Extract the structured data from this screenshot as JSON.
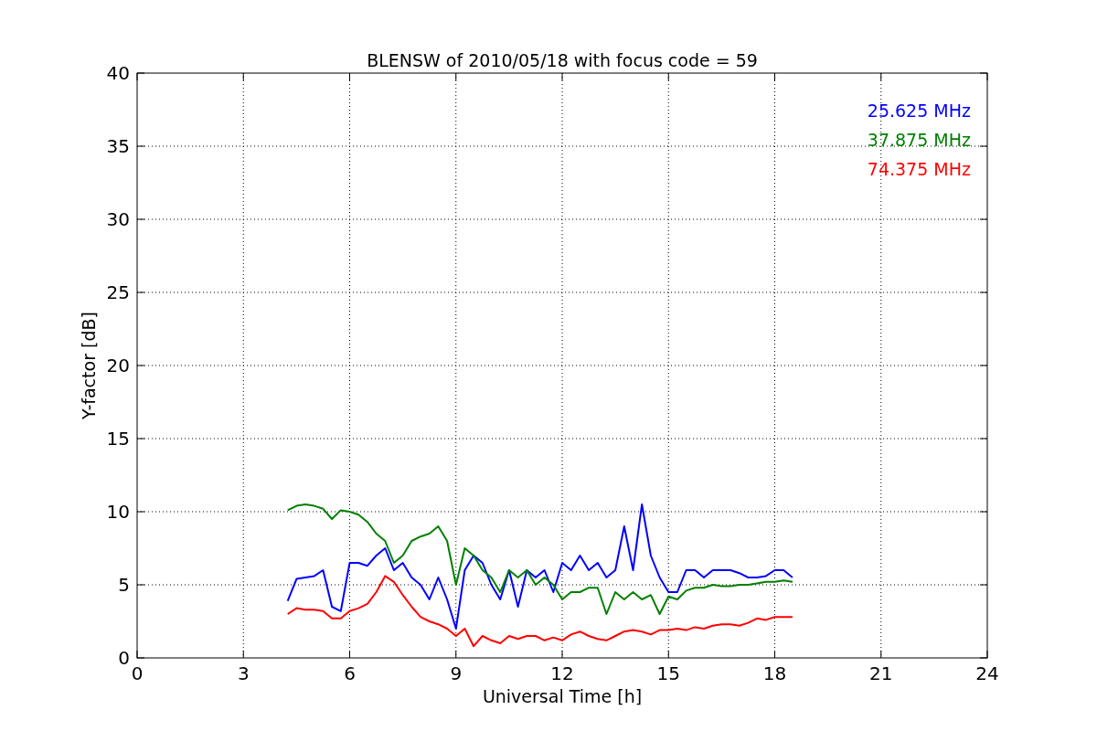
{
  "figure": {
    "chart_data": {
      "type": "line",
      "title": "BLENSW of 2010/05/18 with focus code = 59",
      "xlabel": "Universal Time [h]",
      "ylabel": "Y-factor [dB]",
      "x": [
        4.25,
        4.5,
        4.75,
        5,
        5.25,
        5.5,
        5.75,
        6,
        6.25,
        6.5,
        6.75,
        7,
        7.25,
        7.5,
        7.75,
        8,
        8.25,
        8.5,
        8.75,
        9,
        9.25,
        9.5,
        9.75,
        10,
        10.25,
        10.5,
        10.75,
        11,
        11.25,
        11.5,
        11.75,
        12,
        12.25,
        12.5,
        12.75,
        13,
        13.25,
        13.5,
        13.75,
        14,
        14.25,
        14.5,
        14.75,
        15,
        15.25,
        15.5,
        15.75,
        16,
        16.25,
        16.5,
        16.75,
        17,
        17.25,
        17.5,
        17.75,
        18,
        18.25,
        18.5
      ],
      "series": [
        {
          "name": "25.625 MHz",
          "color": "#0000ff",
          "values": [
            3.9,
            5.4,
            5.5,
            5.6,
            6.0,
            3.5,
            3.2,
            6.5,
            6.5,
            6.3,
            7.0,
            7.5,
            6.0,
            6.5,
            5.5,
            5.0,
            4.0,
            5.5,
            4.0,
            2.0,
            6.0,
            7.0,
            6.5,
            5.0,
            4.0,
            6.0,
            3.5,
            6.0,
            5.5,
            6.0,
            4.5,
            6.5,
            6.0,
            7.0,
            6.0,
            6.5,
            5.5,
            6.0,
            9.0,
            6.0,
            10.5,
            7.0,
            5.5,
            4.5,
            4.5,
            6.0,
            6.0,
            5.5,
            6.0,
            6.0,
            6.0,
            5.8,
            5.5,
            5.5,
            5.6,
            6.0,
            6.0,
            5.5
          ]
        },
        {
          "name": "37.875 MHz",
          "color": "#008000",
          "values": [
            10.1,
            10.4,
            10.5,
            10.4,
            10.2,
            9.5,
            10.1,
            10.0,
            9.8,
            9.3,
            8.5,
            8.0,
            6.5,
            7.0,
            8.0,
            8.3,
            8.5,
            9.0,
            8.0,
            5.0,
            7.5,
            7.0,
            6.0,
            5.5,
            4.5,
            6.0,
            5.5,
            6.0,
            5.0,
            5.5,
            5.0,
            4.0,
            4.5,
            4.5,
            4.8,
            4.8,
            3.0,
            4.5,
            4.0,
            4.5,
            4.0,
            4.3,
            3.0,
            4.2,
            4.0,
            4.6,
            4.8,
            4.8,
            5.0,
            4.9,
            4.9,
            5.0,
            5.0,
            5.1,
            5.2,
            5.2,
            5.3,
            5.2
          ]
        },
        {
          "name": "74.375 MHz",
          "color": "#ff0000",
          "values": [
            3.0,
            3.4,
            3.3,
            3.3,
            3.2,
            2.7,
            2.7,
            3.2,
            3.4,
            3.7,
            4.5,
            5.6,
            5.2,
            4.3,
            3.5,
            2.8,
            2.5,
            2.3,
            2.0,
            1.5,
            2.0,
            0.8,
            1.5,
            1.2,
            1.0,
            1.5,
            1.3,
            1.5,
            1.5,
            1.2,
            1.4,
            1.2,
            1.6,
            1.8,
            1.5,
            1.3,
            1.2,
            1.5,
            1.8,
            1.9,
            1.8,
            1.6,
            1.9,
            1.9,
            2.0,
            1.9,
            2.1,
            2.0,
            2.2,
            2.3,
            2.3,
            2.2,
            2.4,
            2.7,
            2.6,
            2.8,
            2.8,
            2.8
          ]
        }
      ],
      "xlim": [
        0,
        24
      ],
      "ylim": [
        0,
        40
      ],
      "xticks": [
        0,
        3,
        6,
        9,
        12,
        15,
        18,
        21,
        24
      ],
      "yticks": [
        0,
        5,
        10,
        15,
        20,
        25,
        30,
        35,
        40
      ],
      "grid": true
    }
  }
}
